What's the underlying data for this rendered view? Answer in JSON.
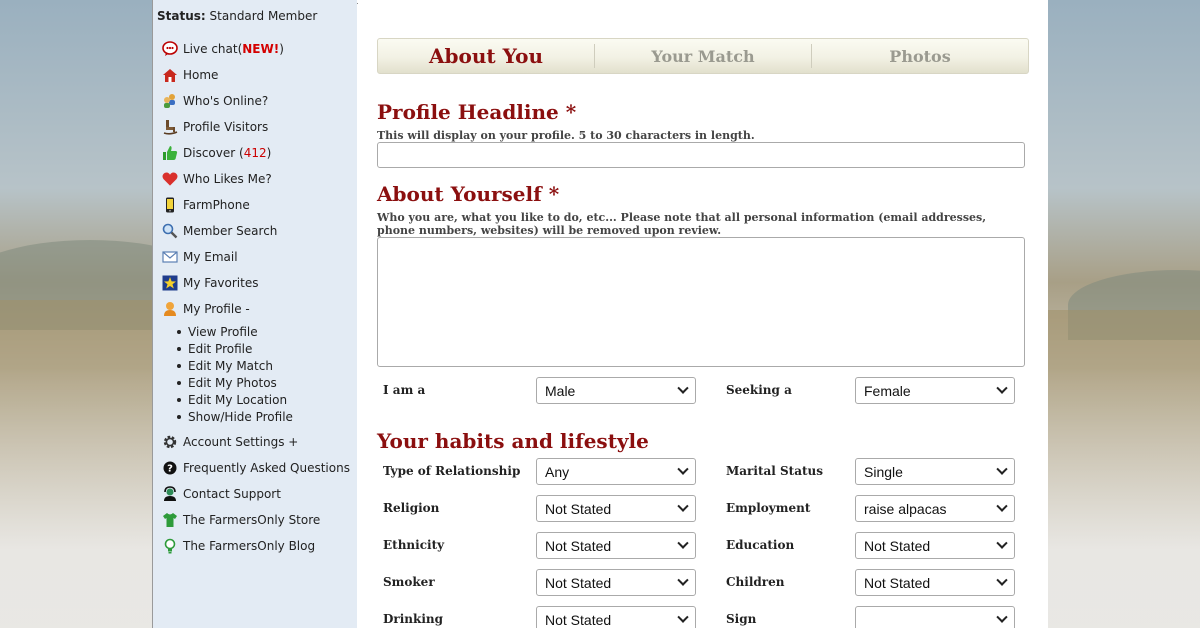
{
  "sidebar": {
    "status_label": "Status:",
    "status_value": "Standard Member",
    "items": [
      {
        "label": "Live chat(",
        "badge": "NEW!",
        "suffix": ")",
        "icon": "chat-bubble-icon"
      },
      {
        "label": "Home",
        "icon": "home-icon"
      },
      {
        "label": "Who's Online?",
        "icon": "users-online-icon"
      },
      {
        "label": "Profile Visitors",
        "icon": "rocking-chair-icon"
      },
      {
        "label": "Discover (",
        "count": "412",
        "suffix": ")",
        "icon": "thumbs-up-icon"
      },
      {
        "label": "Who Likes Me?",
        "icon": "heart-icon"
      },
      {
        "label": "FarmPhone",
        "icon": "phone-icon"
      },
      {
        "label": "Member Search",
        "icon": "magnifier-icon"
      },
      {
        "label": "My Email",
        "icon": "envelope-icon"
      },
      {
        "label": "My Favorites",
        "icon": "star-icon"
      },
      {
        "label": "My Profile -",
        "icon": "profile-person-icon"
      },
      {
        "label": "Account Settings +",
        "icon": "gear-icon"
      },
      {
        "label": "Frequently Asked Questions",
        "icon": "question-icon"
      },
      {
        "label": "Contact Support",
        "icon": "support-agent-icon"
      },
      {
        "label": "The FarmersOnly Store",
        "icon": "tshirt-icon"
      },
      {
        "label": "The FarmersOnly Blog",
        "icon": "lightbulb-icon"
      }
    ],
    "profile_sub": [
      "View Profile",
      "Edit Profile",
      "Edit My Match",
      "Edit My Photos",
      "Edit My Location",
      "Show/Hide Profile"
    ]
  },
  "tabs": [
    {
      "label": "About You",
      "active": true
    },
    {
      "label": "Your Match",
      "active": false
    },
    {
      "label": "Photos",
      "active": false
    }
  ],
  "headline": {
    "title": "Profile Headline",
    "required": "*",
    "hint": "This will display on your profile. 5 to 30 characters in length.",
    "value": ""
  },
  "about": {
    "title": "About Yourself",
    "required": "*",
    "hint": "Who you are, what you like to do, etc... Please note that all personal information (email addresses, phone numbers, websites) will be removed upon review.",
    "value": ""
  },
  "gender": {
    "i_am_label": "I am a",
    "i_am_value": "Male",
    "seeking_label": "Seeking a",
    "seeking_value": "Female"
  },
  "habits": {
    "title": "Your habits and lifestyle",
    "rows": [
      {
        "left_label": "Type of Relationship",
        "left_value": "Any",
        "right_label": "Marital Status",
        "right_value": "Single"
      },
      {
        "left_label": "Religion",
        "left_value": "Not Stated",
        "right_label": "Employment",
        "right_value": "raise alpacas"
      },
      {
        "left_label": "Ethnicity",
        "left_value": "Not Stated",
        "right_label": "Education",
        "right_value": "Not Stated"
      },
      {
        "left_label": "Smoker",
        "left_value": "Not Stated",
        "right_label": "Children",
        "right_value": "Not Stated"
      },
      {
        "left_label": "Drinking",
        "left_value": "Not Stated",
        "right_label": "Sign",
        "right_value": ""
      }
    ]
  },
  "colors": {
    "accent": "#8b0f0f",
    "sidebar_bg": "#e3ebf4",
    "new_badge": "#d40000"
  }
}
